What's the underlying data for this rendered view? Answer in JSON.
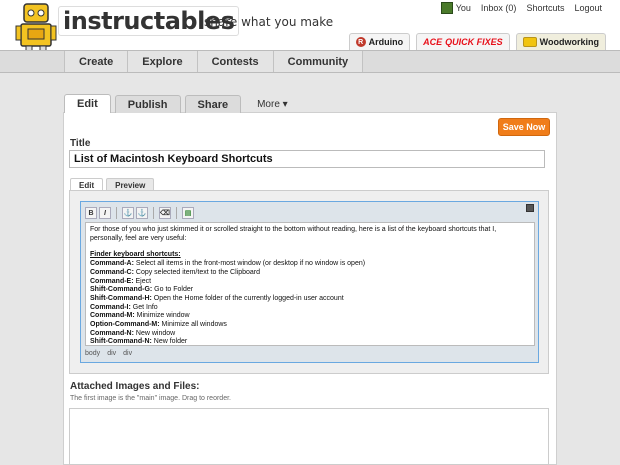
{
  "header": {
    "logo": "instructables",
    "tagline": "share what you make"
  },
  "toplinks": {
    "you": "You",
    "inbox": "Inbox (0)",
    "shortcuts": "Shortcuts",
    "logout": "Logout"
  },
  "partners": [
    {
      "label": "Arduino"
    },
    {
      "label": "QUICK FIXES",
      "prefix": "ACE"
    },
    {
      "label": "Woodworking"
    }
  ],
  "nav": [
    "Create",
    "Explore",
    "Contests",
    "Community"
  ],
  "tabs": {
    "edit": "Edit",
    "publish": "Publish",
    "share": "Share",
    "more": "More ▾"
  },
  "save_button": "Save Now",
  "title": {
    "label": "Title",
    "value": "List of Macintosh  Keyboard Shortcuts"
  },
  "editor_tabs": {
    "edit": "Edit",
    "preview": "Preview"
  },
  "toolbar": {
    "bold": "B",
    "italic": "I"
  },
  "content": {
    "intro": "For those of you who just skimmed it or scrolled straight to the bottom without reading, here is a list of the keyboard shortcuts that I, personally, feel are very useful:",
    "section_heading": "Finder keyboard shortcuts:",
    "shortcuts": [
      {
        "key": "Command-A:",
        "desc": " Select all items in the front-most window (or desktop if no window is open)"
      },
      {
        "key": "Command-C:",
        "desc": " Copy selected item/text to the Clipboard"
      },
      {
        "key": "Command-E:",
        "desc": " Eject"
      },
      {
        "key": "Shift-Command-G:",
        "desc": " Go to Folder"
      },
      {
        "key": "Shift-Command-H:",
        "desc": " Open the Home folder of the currently logged-in user account"
      },
      {
        "key": "Command-I:",
        "desc": " Get Info"
      },
      {
        "key": "Command-M:",
        "desc": " Minimize window"
      },
      {
        "key": "Option-Command-M:",
        "desc": " Minimize all windows"
      },
      {
        "key": "Command-N:",
        "desc": " New window"
      },
      {
        "key": "Shift-Command-N:",
        "desc": " New folder"
      }
    ]
  },
  "pathbar": [
    "body",
    "div",
    "div"
  ],
  "attachments": {
    "label": "Attached Images and Files:",
    "hint": "The first image is the \"main\" image. Drag to reorder."
  },
  "colors": {
    "save_orange": "#f07d1a",
    "editor_border": "#6aa8e0",
    "ace_red": "#e8101a"
  }
}
